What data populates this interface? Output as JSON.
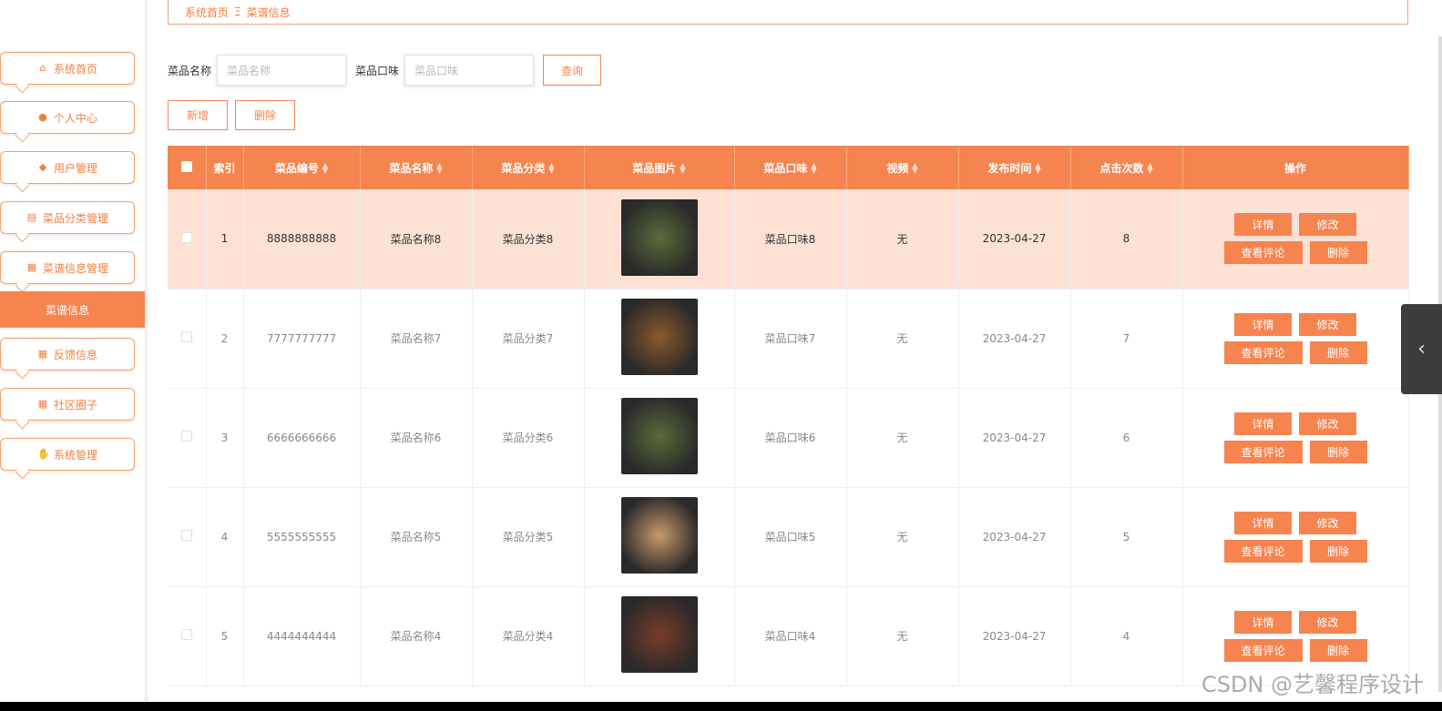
{
  "sidebar": {
    "items": [
      {
        "label": "系统首页",
        "icon": "home-icon",
        "glyph": "⌂"
      },
      {
        "label": "个人中心",
        "icon": "user-icon",
        "glyph": "●"
      },
      {
        "label": "用户管理",
        "icon": "location-icon",
        "glyph": "◆"
      },
      {
        "label": "菜品分类管理",
        "icon": "chart-icon",
        "glyph": "▤"
      },
      {
        "label": "菜谱信息管理",
        "icon": "grid-icon",
        "glyph": "▦"
      },
      {
        "label": "反馈信息",
        "icon": "grid-icon",
        "glyph": "▦"
      },
      {
        "label": "社区圈子",
        "icon": "grid-icon",
        "glyph": "▦"
      },
      {
        "label": "系统管理",
        "icon": "thumb-icon",
        "glyph": "✋"
      }
    ],
    "active_sub": "菜谱信息"
  },
  "breadcrumb": {
    "home": "系统首页",
    "sep": "Ξ",
    "current": "菜谱信息"
  },
  "search": {
    "name_label": "菜品名称",
    "name_placeholder": "菜品名称",
    "taste_label": "菜品口味",
    "taste_placeholder": "菜品口味",
    "query_button": "查询"
  },
  "actions": {
    "add": "新增",
    "delete": "删除"
  },
  "table": {
    "headers": [
      "索引",
      "菜品编号",
      "菜品名称",
      "菜品分类",
      "菜品图片",
      "菜品口味",
      "视频",
      "发布时间",
      "点击次数",
      "操作"
    ],
    "rows": [
      {
        "index": "1",
        "code": "8888888888",
        "name": "菜品名称8",
        "category": "菜品分类8",
        "taste": "菜品口味8",
        "video": "无",
        "date": "2023-04-27",
        "clicks": "8",
        "img": "#5a6b3a"
      },
      {
        "index": "2",
        "code": "7777777777",
        "name": "菜品名称7",
        "category": "菜品分类7",
        "taste": "菜品口味7",
        "video": "无",
        "date": "2023-04-27",
        "clicks": "7",
        "img": "#8b5a2b"
      },
      {
        "index": "3",
        "code": "6666666666",
        "name": "菜品名称6",
        "category": "菜品分类6",
        "taste": "菜品口味6",
        "video": "无",
        "date": "2023-04-27",
        "clicks": "6",
        "img": "#5a6b3a"
      },
      {
        "index": "4",
        "code": "5555555555",
        "name": "菜品名称5",
        "category": "菜品分类5",
        "taste": "菜品口味5",
        "video": "无",
        "date": "2023-04-27",
        "clicks": "5",
        "img": "#c89a6a"
      },
      {
        "index": "5",
        "code": "4444444444",
        "name": "菜品名称4",
        "category": "菜品分类4",
        "taste": "菜品口味4",
        "video": "无",
        "date": "2023-04-27",
        "clicks": "4",
        "img": "#7a3b2a"
      }
    ],
    "ops": {
      "detail": "详情",
      "edit": "修改",
      "reviews": "查看评论",
      "delete": "删除"
    }
  },
  "watermark": "CSDN @艺馨程序设计",
  "accent": "#f5844f"
}
